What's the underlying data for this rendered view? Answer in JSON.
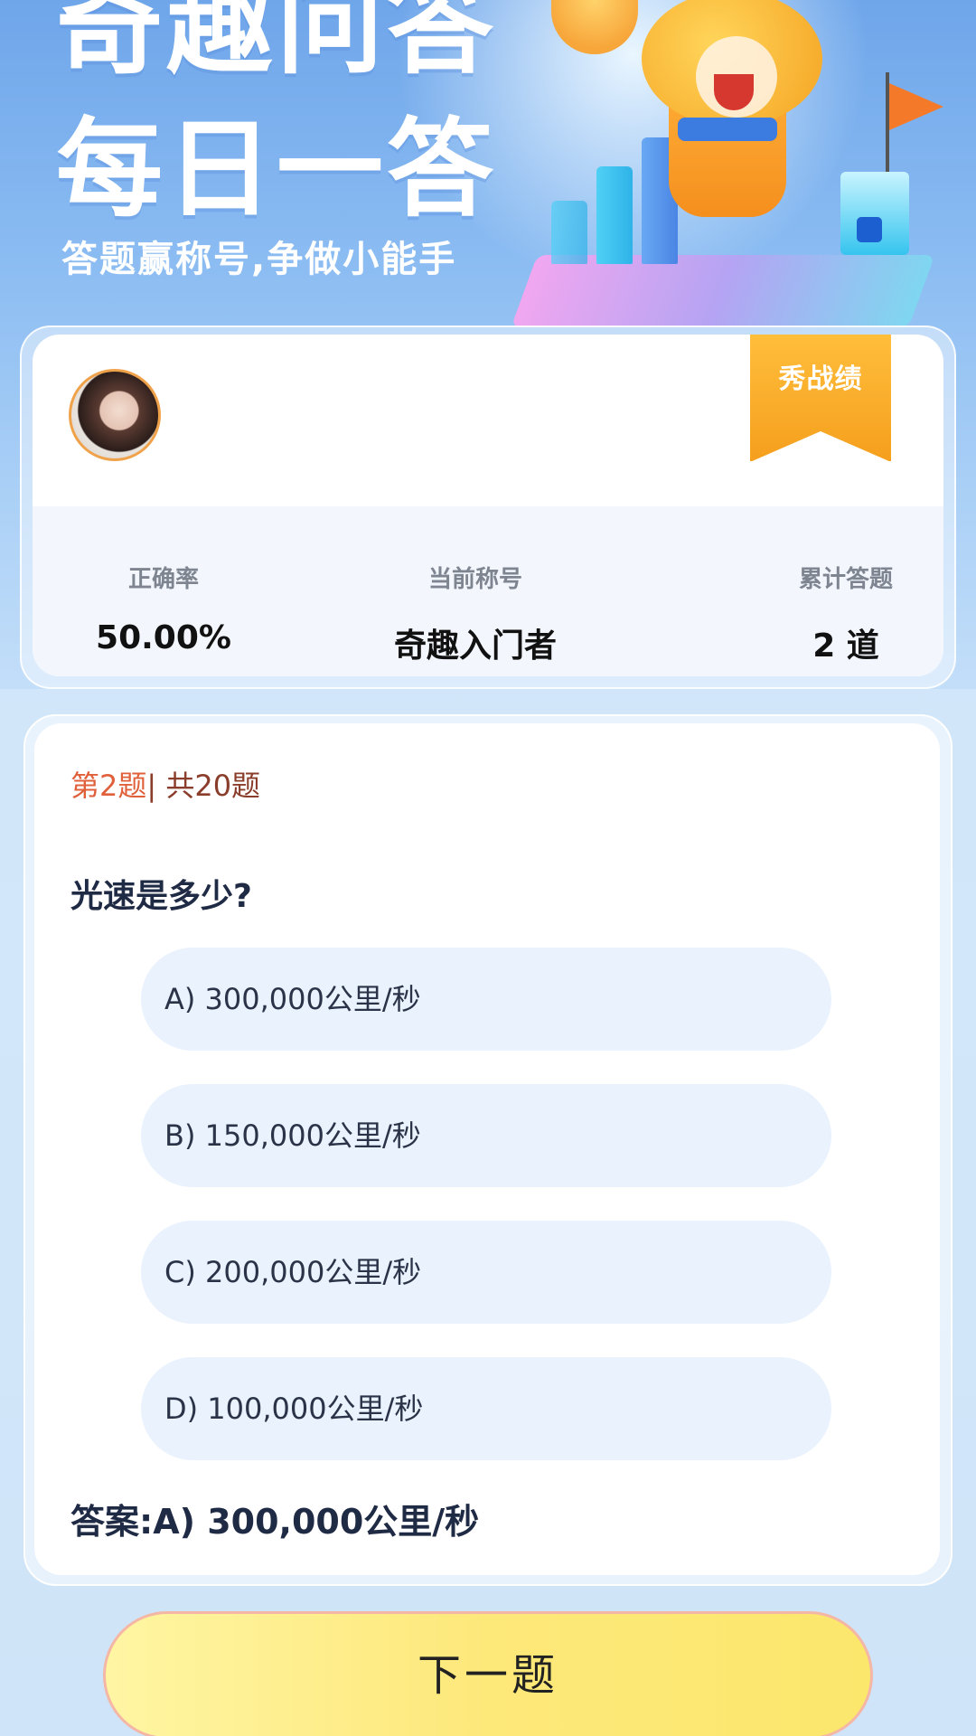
{
  "banner": {
    "title_line1": "奇趣问答",
    "title_line2": "每日一答",
    "subtitle": "答题赢称号,争做小能手"
  },
  "profile": {
    "badge_label": "秀战绩"
  },
  "stats": {
    "accuracy_label": "正确率",
    "accuracy_value": "50.00%",
    "title_label": "当前称号",
    "title_value": "奇趣入门者",
    "total_label": "累计答题",
    "total_value": "2 道"
  },
  "question": {
    "progress_current": "第2题",
    "progress_total": "| 共20题",
    "text": "光速是多少?",
    "options": [
      "A) 300,000公里/秒",
      "B) 150,000公里/秒",
      "C) 200,000公里/秒",
      "D) 100,000公里/秒"
    ],
    "answer": "答案:A) 300,000公里/秒"
  },
  "next_button_label": "下一题",
  "colors": {
    "progress_current": "#e0603b",
    "progress_total": "#8a3d2a",
    "badge": "#f59f1d",
    "next_button": "#fde87a",
    "option_bg": "#e9f2fd"
  }
}
